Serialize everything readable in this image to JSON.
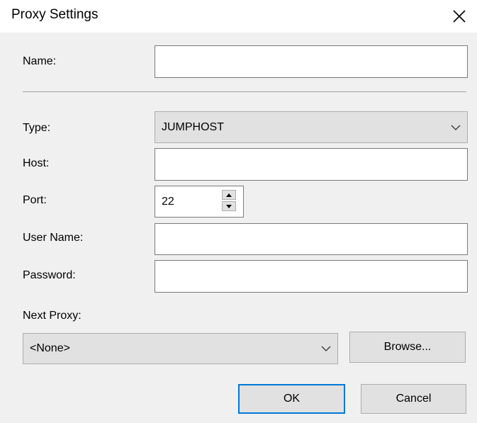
{
  "dialog": {
    "title": "Proxy Settings"
  },
  "fields": {
    "name": {
      "label": "Name:",
      "value": ""
    },
    "type": {
      "label": "Type:",
      "value": "JUMPHOST"
    },
    "host": {
      "label": "Host:",
      "value": ""
    },
    "port": {
      "label": "Port:",
      "value": "22"
    },
    "user_name": {
      "label": "User Name:",
      "value": ""
    },
    "password": {
      "label": "Password:",
      "value": ""
    },
    "next_proxy": {
      "label": "Next Proxy:",
      "value": "<None>"
    }
  },
  "buttons": {
    "browse": "Browse...",
    "ok": "OK",
    "cancel": "Cancel"
  },
  "icons": {
    "close": "close-icon",
    "dropdown": "chevron-down-icon",
    "spin_up": "spin-up-icon",
    "spin_down": "spin-down-icon"
  },
  "colors": {
    "default_button_border": "#0078d7",
    "dialog_bg": "#f0f0f0"
  }
}
